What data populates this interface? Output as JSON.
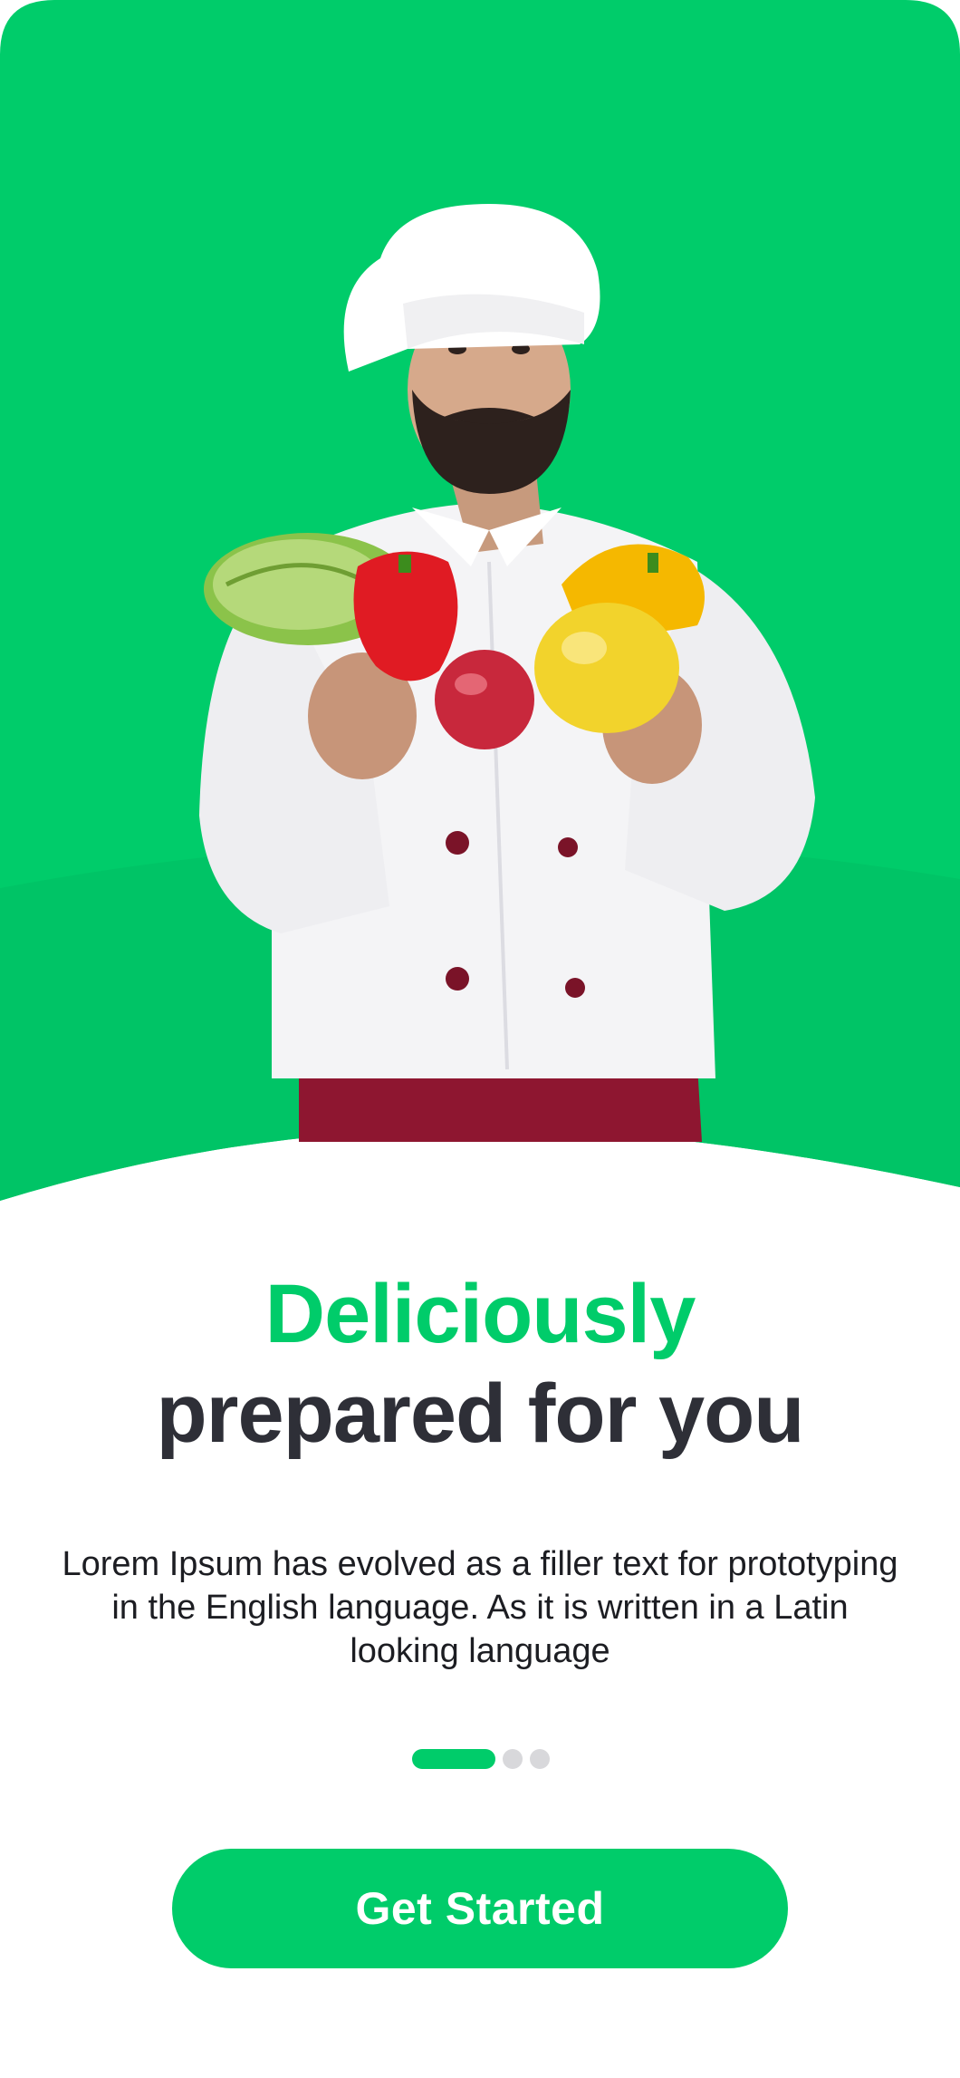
{
  "colors": {
    "brand_green": "#00cc6a",
    "brand_green_dark": "#00c466",
    "heading_dark": "#2e2f37",
    "dot_inactive": "#d8d8db",
    "button_text": "#ffffff"
  },
  "hero": {
    "image": "chef-holding-vegetables"
  },
  "headline": {
    "accent": "Deliciously",
    "main": "prepared for you"
  },
  "body": {
    "text": "Lorem Ipsum has evolved as a filler text for prototyping in the English language. As it is written in a Latin looking language"
  },
  "pagination": {
    "current": 1,
    "total": 3
  },
  "cta": {
    "label": "Get Started"
  }
}
